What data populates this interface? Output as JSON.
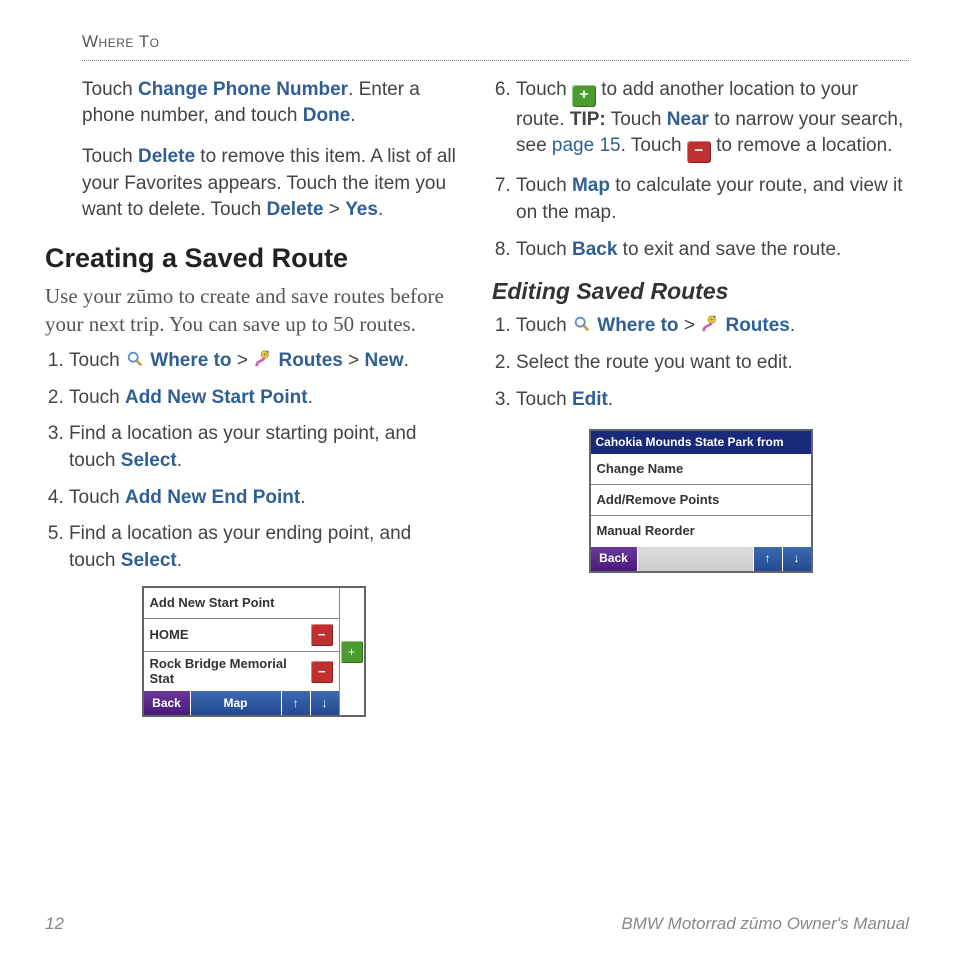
{
  "header": "Where To",
  "col1": {
    "p1_a": "Touch ",
    "p1_link1": "Change Phone Number",
    "p1_b": ". Enter a phone number, and touch ",
    "p1_link2": "Done",
    "p1_c": ".",
    "p2_a": "Touch ",
    "p2_link1": "Delete",
    "p2_b": " to remove this item. A list of all your Favorites appears. Touch the item you want to delete. Touch ",
    "p2_link2": "Delete",
    "p2_c": " > ",
    "p2_link3": "Yes",
    "p2_d": "."
  },
  "section_title": "Creating a Saved Route",
  "intro": "Use your zūmo to create and save routes before your next trip. You can save up to 50 routes.",
  "steps_a": {
    "s1_a": "Touch ",
    "s1_link1": " Where to",
    "s1_b": " > ",
    "s1_link2": " Routes",
    "s1_c": " > ",
    "s1_link3": "New",
    "s1_d": ".",
    "s2_a": "Touch ",
    "s2_link": "Add New Start Point",
    "s2_b": ".",
    "s3_a": "Find a location as your starting point, and touch ",
    "s3_link": "Select",
    "s3_b": ".",
    "s4_a": "Touch ",
    "s4_link": "Add New End Point",
    "s4_b": ".",
    "s5_a": "Find a location as your ending point, and touch ",
    "s5_link": "Select",
    "s5_b": "."
  },
  "device1": {
    "row1": "Add New Start Point",
    "row2": "HOME",
    "row3": "Rock Bridge Memorial Stat",
    "back": "Back",
    "map": "Map"
  },
  "steps_b": {
    "s6_a": "Touch ",
    "s6_b": " to add another location to your route. ",
    "s6_tip": "TIP:",
    "s6_c": " Touch ",
    "s6_link1": "Near",
    "s6_d": " to narrow your search, see ",
    "s6_page": "page 15",
    "s6_e": ". Touch ",
    "s6_f": " to remove a location.",
    "s7_a": "Touch ",
    "s7_link": "Map",
    "s7_b": " to calculate your route, and view it on the map.",
    "s8_a": "Touch ",
    "s8_link": "Back",
    "s8_b": " to exit and save the route."
  },
  "subsection": "Editing Saved Routes",
  "steps_c": {
    "s1_a": "Touch ",
    "s1_link1": " Where to",
    "s1_b": " > ",
    "s1_link2": " Routes",
    "s1_c": ".",
    "s2": "Select the route you want to edit.",
    "s3_a": "Touch ",
    "s3_link": "Edit",
    "s3_b": "."
  },
  "device2": {
    "title": "Cahokia Mounds State Park from",
    "row1": "Change Name",
    "row2": "Add/Remove Points",
    "row3": "Manual Reorder",
    "back": "Back"
  },
  "footer": {
    "page": "12",
    "title": "BMW Motorrad zūmo Owner's Manual"
  }
}
